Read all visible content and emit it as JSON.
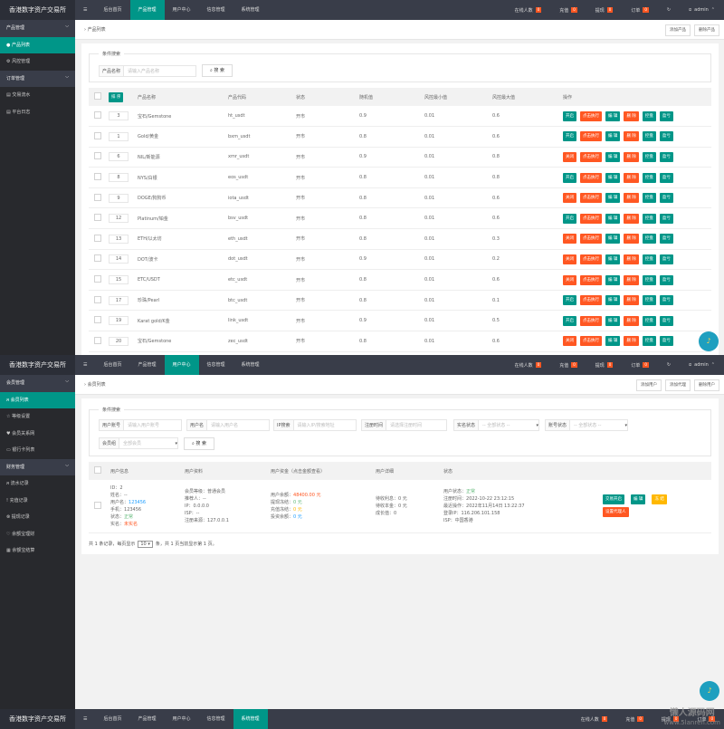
{
  "app_title": "香港数字资产交易所",
  "nav": {
    "menu_icon": "☰",
    "items": [
      "后台首页",
      "产品管理",
      "用户中心",
      "信息管理",
      "系统管理"
    ]
  },
  "header_right": {
    "online_label": "在线人数",
    "online": "0",
    "recharge_label": "充值",
    "recharge": "0",
    "withdraw_label": "提现",
    "withdraw": "0",
    "order_label": "订单",
    "order": "0",
    "user": "admin"
  },
  "colors": {
    "accent": "#009688",
    "danger": "#ff5722",
    "warn": "#ffb800",
    "header": "#393d49"
  },
  "products": {
    "sidebar": [
      {
        "label": "产品管理",
        "type": "group"
      },
      {
        "label": "产品列表",
        "type": "active",
        "icon": "●"
      },
      {
        "label": "风控管理",
        "icon": "⚙"
      },
      {
        "label": "订单管理",
        "type": "group"
      },
      {
        "label": "交易流水",
        "icon": "▤"
      },
      {
        "label": "平台日志",
        "icon": "▤"
      }
    ],
    "breadcrumb": "产品列表",
    "toolbar": [
      "添加产品",
      "删除产品"
    ],
    "search": {
      "legend": "条件搜索",
      "label": "产品名称",
      "placeholder": "请输入产品名称",
      "button": "搜 索"
    },
    "columns": [
      "排 序",
      "产品名称",
      "产品代码",
      "状态",
      "随机值",
      "风控最小值",
      "风控最大值",
      "操作"
    ],
    "actions": [
      "点击执行",
      "编 辑",
      "删 除",
      "控盘",
      "盈亏"
    ],
    "rows": [
      {
        "sort": "3",
        "name": "宝石/Gemstone",
        "code": "ht_usdt",
        "status": "开市",
        "rand": "0.9",
        "min": "0.01",
        "max": "0.6",
        "toggle": "开启"
      },
      {
        "sort": "1",
        "name": "Gold/黄金",
        "code": "bxm_usdt",
        "status": "开市",
        "rand": "0.8",
        "min": "0.01",
        "max": "0.6",
        "toggle": "开启"
      },
      {
        "sort": "6",
        "name": "NIL/新能源",
        "code": "xmr_usdt",
        "status": "开市",
        "rand": "0.9",
        "min": "0.01",
        "max": "0.8",
        "toggle": "关闭"
      },
      {
        "sort": "8",
        "name": "NYS/白银",
        "code": "eos_usdt",
        "status": "开市",
        "rand": "0.8",
        "min": "0.01",
        "max": "0.8",
        "toggle": "开启"
      },
      {
        "sort": "9",
        "name": "DOGE/狗狗币",
        "code": "iota_usdt",
        "status": "开市",
        "rand": "0.8",
        "min": "0.01",
        "max": "0.6",
        "toggle": "关闭"
      },
      {
        "sort": "12",
        "name": "Platinum/铂金",
        "code": "bsv_usdt",
        "status": "开市",
        "rand": "0.8",
        "min": "0.01",
        "max": "0.6",
        "toggle": "开启"
      },
      {
        "sort": "13",
        "name": "ETH/以太坊",
        "code": "eth_usdt",
        "status": "开市",
        "rand": "0.8",
        "min": "0.01",
        "max": "0.3",
        "toggle": "关闭"
      },
      {
        "sort": "14",
        "name": "DOT/波卡",
        "code": "dot_usdt",
        "status": "开市",
        "rand": "0.9",
        "min": "0.01",
        "max": "0.2",
        "toggle": "关闭"
      },
      {
        "sort": "15",
        "name": "ETC/USDT",
        "code": "etc_usdt",
        "status": "开市",
        "rand": "0.8",
        "min": "0.01",
        "max": "0.6",
        "toggle": "关闭"
      },
      {
        "sort": "17",
        "name": "珍珠/Pearl",
        "code": "btc_usdt",
        "status": "开市",
        "rand": "0.8",
        "min": "0.01",
        "max": "0.1",
        "toggle": "开启"
      },
      {
        "sort": "19",
        "name": "Karat gold/K金",
        "code": "link_usdt",
        "status": "开市",
        "rand": "0.9",
        "min": "0.01",
        "max": "0.5",
        "toggle": "开启"
      },
      {
        "sort": "20",
        "name": "宝石/Gemstone",
        "code": "zec_usdt",
        "status": "开市",
        "rand": "0.8",
        "min": "0.01",
        "max": "0.6",
        "toggle": "关闭"
      }
    ]
  },
  "members": {
    "sidebar": [
      {
        "label": "会员管理",
        "type": "group"
      },
      {
        "label": "会员列表",
        "type": "active",
        "icon": "ᴙ"
      },
      {
        "label": "等级设置",
        "icon": "☆"
      },
      {
        "label": "会员关系网",
        "icon": "♥"
      },
      {
        "label": "银行卡列表",
        "icon": "▭"
      },
      {
        "label": "财务管理",
        "type": "group"
      },
      {
        "label": "流水记录",
        "icon": "ᴙ"
      },
      {
        "label": "充值记录",
        "icon": "!"
      },
      {
        "label": "提现记录",
        "icon": "⊗"
      },
      {
        "label": "余额宝理财",
        "icon": "♡"
      },
      {
        "label": "余额宝结算",
        "icon": "▦"
      }
    ],
    "breadcrumb": "会员列表",
    "toolbar": [
      "添加用户",
      "添加代理",
      "删除用户"
    ],
    "search": {
      "legend": "条件搜索",
      "fields": [
        {
          "label": "用户账号",
          "placeholder": "请输入用户账号"
        },
        {
          "label": "用户名",
          "placeholder": "请输入用户名"
        },
        {
          "label": "IP搜索",
          "placeholder": "请输入IP/搜索地址"
        },
        {
          "label": "注册时间",
          "placeholder": "请选择注册时间"
        },
        {
          "label": "实名状态",
          "placeholder": "-- 全部状态 --"
        },
        {
          "label": "账号状态",
          "placeholder": "-- 全部状态 --"
        },
        {
          "label": "会员组",
          "placeholder": "全部会员"
        }
      ],
      "button": "搜 索"
    },
    "columns": [
      "用户信息",
      "用户资料",
      "用户资金（点击金额查看）",
      "用户详细",
      "状态"
    ],
    "row": {
      "info": [
        [
          "ID：",
          "2",
          ""
        ],
        [
          "姓名：",
          "--",
          ""
        ],
        [
          "用户名：",
          "123456",
          "blu"
        ],
        [
          "手机：",
          "123456",
          ""
        ],
        [
          "状态：",
          "正常",
          "grn"
        ],
        [
          "实名：",
          "未实名",
          "red"
        ]
      ],
      "profile": [
        [
          "会员等级：",
          "普通会员",
          ""
        ],
        [
          "推荐人：",
          "--",
          ""
        ],
        [
          "IP：",
          "0.0.0.0",
          ""
        ],
        [
          "ISP：",
          "--",
          ""
        ],
        [
          "注册来源：",
          "127.0.0.1",
          ""
        ]
      ],
      "funds": [
        [
          "用户余额：",
          "48400.00 元",
          "red"
        ],
        [
          "提现冻结：",
          "0 元",
          "grn"
        ],
        [
          "充值冻结：",
          "0 元",
          "org"
        ],
        [
          "投资余额：",
          "0 元",
          "blu"
        ]
      ],
      "detail": [
        [
          "待收利息：",
          "0 元",
          ""
        ],
        [
          "待收本金：",
          "0 元",
          ""
        ],
        [
          "成长值：",
          "0",
          ""
        ]
      ],
      "status": [
        [
          "用户状态：",
          "正常",
          "grn"
        ],
        [
          "注册时间：",
          "2022-10-22 23:12:15",
          ""
        ],
        [
          "最近操作：",
          "2022年11月14日 13:22:37",
          ""
        ],
        [
          "登录IP：",
          "116.206.101.158",
          ""
        ],
        [
          "ISP：",
          "中国香港",
          ""
        ]
      ],
      "buttons": [
        "交易开启",
        "编 辑",
        "冻 结",
        "设置代理人"
      ]
    },
    "pagination": {
      "prefix": "共 1 条记录，每页显示",
      "size": "10",
      "suffix": "条，共 1 页当前显示第 1 页。"
    }
  },
  "watermark": {
    "text": "懒人源码网",
    "url": "www.5lanren.com"
  }
}
